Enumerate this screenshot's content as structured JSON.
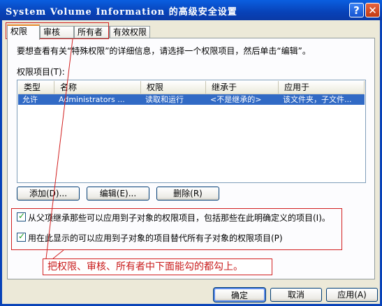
{
  "window": {
    "title": "System Volume Information 的高级安全设置"
  },
  "tabs": [
    {
      "label": "权限"
    },
    {
      "label": "审核"
    },
    {
      "label": "所有者"
    },
    {
      "label": "有效权限"
    }
  ],
  "info_text": "要想查看有关“特殊权限”的详细信息，请选择一个权限项目，然后单击“编辑”。",
  "list_label": "权限项目(T):",
  "columns": [
    "类型",
    "名称",
    "权限",
    "继承于",
    "应用于"
  ],
  "rows": [
    [
      "允许",
      "Administrators ...",
      "读取和运行",
      "<不是继承的>",
      "该文件夹，子文件..."
    ]
  ],
  "buttons": {
    "add": "添加(D)...",
    "edit": "编辑(E)...",
    "remove": "删除(R)"
  },
  "checkboxes": [
    "从父项继承那些可以应用到子对象的权限项目，包括那些在此明确定义的项目(I)。",
    "用在此显示的可以应用到子对象的项目替代所有子对象的权限项目(P)"
  ],
  "annotation": "把权限、审核、所有者中下面能勾的都勾上。",
  "footer": {
    "ok": "确定",
    "cancel": "取消",
    "apply": "应用(A)"
  },
  "colors": {
    "titlebar": "#0842b8",
    "selection": "#316ac5",
    "annotation": "#d21f1f"
  }
}
